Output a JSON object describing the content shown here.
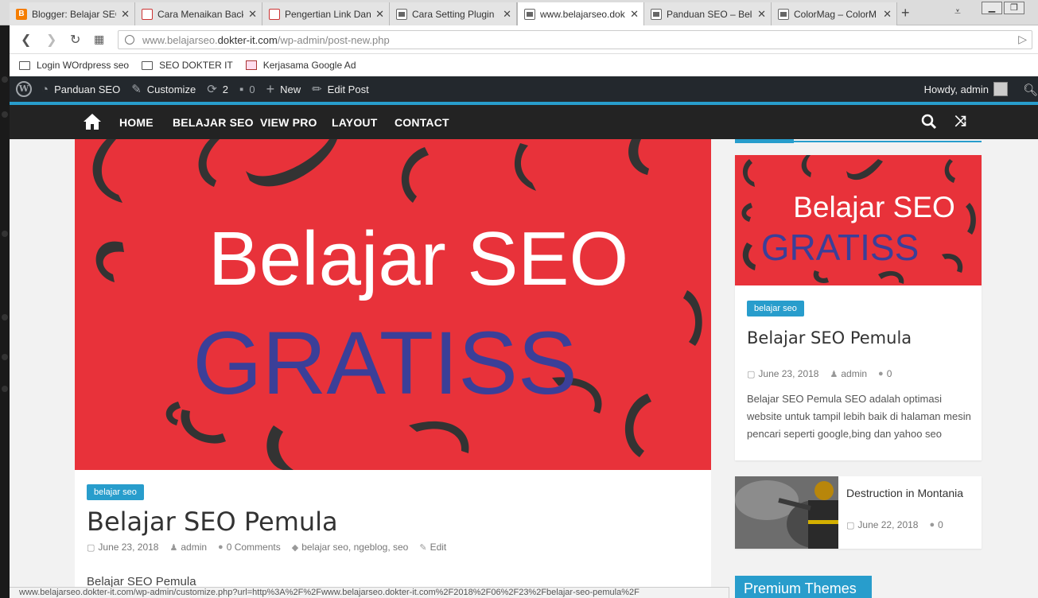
{
  "browser": {
    "tabs": [
      {
        "title": "Blogger: Belajar SEO",
        "favicon": "blogger-icon",
        "active": false
      },
      {
        "title": "Cara Menaikan Back",
        "favicon": "image-icon",
        "active": false
      },
      {
        "title": "Pengertian Link Dan",
        "favicon": "image-icon",
        "active": false
      },
      {
        "title": "Cara Setting Plugin",
        "favicon": "page-icon",
        "active": false
      },
      {
        "title": "www.belajarseo.dok",
        "favicon": "page-icon",
        "active": true
      },
      {
        "title": "Panduan SEO – Bela",
        "favicon": "page-icon",
        "active": false
      },
      {
        "title": "ColorMag – ColorM",
        "favicon": "page-icon",
        "active": false
      }
    ],
    "url_prefix": "www.belajarseo.",
    "url_host": "dokter-it.com",
    "url_path": "/wp-admin/post-new.php",
    "bookmarks": [
      "Login WOrdpress seo",
      "SEO DOKTER IT",
      "Kerjasama Google Ad"
    ],
    "status_url": "www.belajarseo.dokter-it.com/wp-admin/customize.php?url=http%3A%2F%2Fwww.belajarseo.dokter-it.com%2F2018%2F06%2F23%2Fbelajar-seo-pemula%2F"
  },
  "wp_admin_bar": {
    "site_name": "Panduan SEO",
    "customize": "Customize",
    "updates_count": "2",
    "comments_count": "0",
    "new_label": "New",
    "edit_post": "Edit Post",
    "howdy": "Howdy, admin"
  },
  "site_nav": {
    "items": [
      "HOME",
      "BELAJAR SEO",
      "VIEW PRO",
      "LAYOUT",
      "CONTACT"
    ]
  },
  "hero": {
    "line1": "Belajar SEO",
    "line2": "GRATISS",
    "bg_color": "#e8323a",
    "line1_color": "#ffffff",
    "line2_color": "#3b3f98"
  },
  "article": {
    "category": "belajar seo",
    "title": "Belajar SEO Pemula",
    "date": "June 23, 2018",
    "author": "admin",
    "comments": "0 Comments",
    "tags": [
      "belajar seo",
      "ngeblog",
      "seo"
    ],
    "edit": "Edit",
    "body": "Belajar SEO Pemula"
  },
  "sidebar": {
    "featured": {
      "category": "belajar seo",
      "title": "Belajar SEO Pemula",
      "date": "June 23, 2018",
      "author": "admin",
      "comments": "0",
      "excerpt": "Belajar SEO Pemula SEO adalah optimasi website untuk tampil lebih baik di halaman mesin pencari seperti google,bing dan yahoo seo"
    },
    "second": {
      "title": "Destruction in Montania",
      "date": "June 22, 2018",
      "comments": "0"
    },
    "premium_title": "Premium Themes"
  },
  "colors": {
    "accent": "#289dcc",
    "wp_bar": "#23282d",
    "nav_bg": "#232323"
  }
}
